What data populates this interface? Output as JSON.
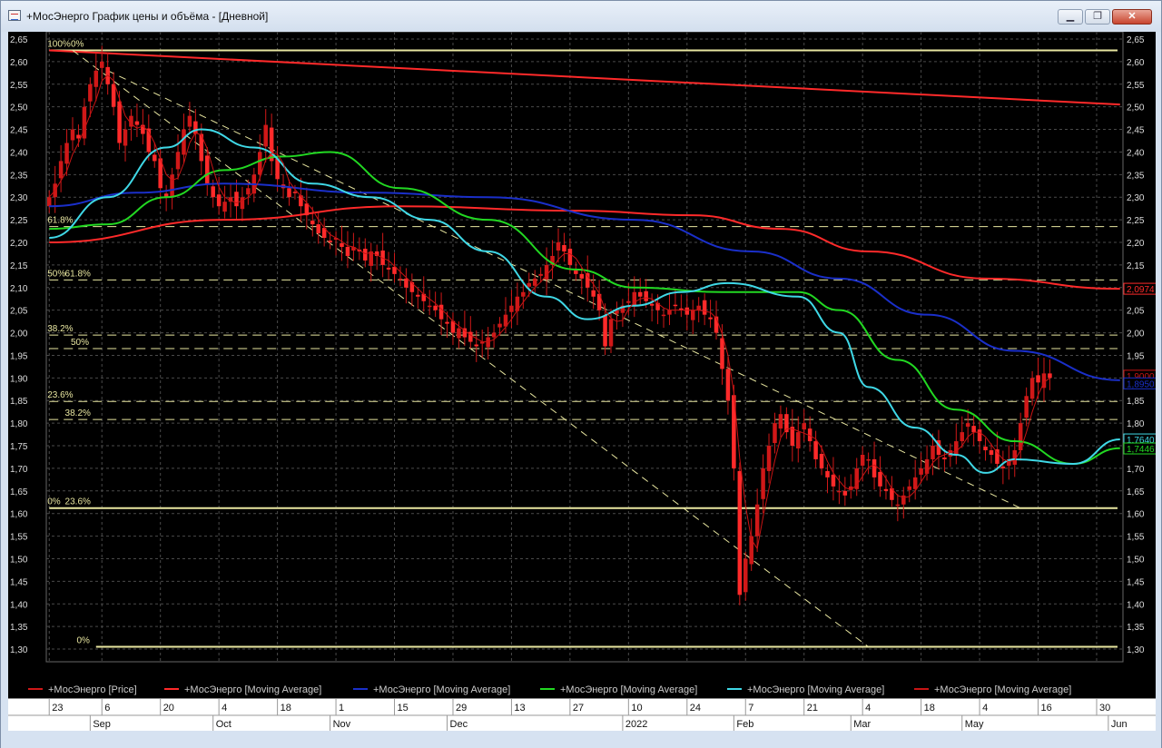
{
  "window": {
    "title": "+МосЭнерго График цены и объёма - [Дневной]",
    "minimize_glyph": "▁",
    "restore_glyph": "❐",
    "close_glyph": "✕"
  },
  "colors": {
    "background": "#000000",
    "grid": "#4a4a4a",
    "candle_up": "#d01818",
    "candle_down": "#ff2a2a",
    "fib_line": "#e8e6a0",
    "ma_red_thin": "#c81414",
    "ma_red_thick": "#ff2a2a",
    "ma_blue": "#1a2fc9",
    "ma_green": "#22d822",
    "ma_cyan": "#3fd8e6"
  },
  "chart_data": {
    "type": "line",
    "y_axis": {
      "min": 1.28,
      "max": 2.65,
      "ticks": [
        "2,65",
        "2,60",
        "2,55",
        "2,50",
        "2,45",
        "2,40",
        "2,35",
        "2,30",
        "2,25",
        "2,20",
        "2,15",
        "2,10",
        "2,05",
        "2,00",
        "1,95",
        "1,90",
        "1,85",
        "1,80",
        "1,75",
        "1,70",
        "1,65",
        "1,60",
        "1,55",
        "1,50",
        "1,45",
        "1,40",
        "1,35",
        "1,30"
      ],
      "tick_values": [
        2.65,
        2.6,
        2.55,
        2.5,
        2.45,
        2.4,
        2.35,
        2.3,
        2.25,
        2.2,
        2.15,
        2.1,
        2.05,
        2.0,
        1.95,
        1.9,
        1.85,
        1.8,
        1.75,
        1.7,
        1.65,
        1.6,
        1.55,
        1.5,
        1.45,
        1.4,
        1.35,
        1.3
      ]
    },
    "x_axis": {
      "days": [
        "23",
        "6",
        "20",
        "4",
        "18",
        "1",
        "15",
        "29",
        "13",
        "27",
        "10",
        "24",
        "7",
        "21",
        "4",
        "18",
        "4",
        "16",
        "30"
      ],
      "day_index": [
        0,
        9,
        19,
        29,
        39,
        49,
        59,
        69,
        79,
        89,
        99,
        109,
        119,
        129,
        139,
        149,
        159,
        169,
        179
      ],
      "months": [
        "Sep",
        "Oct",
        "Nov",
        "Dec",
        "2022",
        "Feb",
        "Mar",
        "May",
        "Jun"
      ],
      "month_index": [
        7,
        28,
        48,
        68,
        98,
        117,
        137,
        156,
        181
      ],
      "count": 184
    },
    "close": [
      2.3,
      2.33,
      2.38,
      2.42,
      2.45,
      2.43,
      2.5,
      2.55,
      2.58,
      2.6,
      2.55,
      2.5,
      2.42,
      2.45,
      2.48,
      2.46,
      2.44,
      2.4,
      2.38,
      2.32,
      2.3,
      2.35,
      2.4,
      2.45,
      2.48,
      2.44,
      2.38,
      2.33,
      2.3,
      2.28,
      2.29,
      2.3,
      2.28,
      2.3,
      2.32,
      2.35,
      2.4,
      2.46,
      2.38,
      2.34,
      2.32,
      2.3,
      2.31,
      2.28,
      2.26,
      2.24,
      2.22,
      2.21,
      2.2,
      2.21,
      2.19,
      2.17,
      2.19,
      2.18,
      2.16,
      2.18,
      2.17,
      2.15,
      2.14,
      2.13,
      2.12,
      2.1,
      2.09,
      2.08,
      2.07,
      2.06,
      2.05,
      2.03,
      2.02,
      2.0,
      2.01,
      1.99,
      1.98,
      1.97,
      1.98,
      1.99,
      2.0,
      2.02,
      2.04,
      2.06,
      2.08,
      2.09,
      2.11,
      2.12,
      2.13,
      2.15,
      2.17,
      2.2,
      2.18,
      2.15,
      2.13,
      2.12,
      2.1,
      2.08,
      2.05,
      1.97,
      2.03,
      2.05,
      2.06,
      2.07,
      2.09,
      2.08,
      2.07,
      2.06,
      2.05,
      2.04,
      2.05,
      2.06,
      2.05,
      2.04,
      2.05,
      2.06,
      2.04,
      2.03,
      2.0,
      1.92,
      1.85,
      1.7,
      1.42,
      1.5,
      1.55,
      1.62,
      1.7,
      1.75,
      1.8,
      1.82,
      1.78,
      1.75,
      1.78,
      1.8,
      1.76,
      1.72,
      1.7,
      1.68,
      1.66,
      1.65,
      1.64,
      1.66,
      1.7,
      1.73,
      1.72,
      1.68,
      1.66,
      1.65,
      1.63,
      1.62,
      1.64,
      1.66,
      1.68,
      1.7,
      1.72,
      1.75,
      1.73,
      1.72,
      1.74,
      1.76,
      1.78,
      1.8,
      1.78,
      1.76,
      1.74,
      1.73,
      1.71,
      1.7,
      1.72,
      1.74,
      1.8,
      1.86,
      1.9,
      1.89,
      1.91,
      1.9
    ],
    "series": [
      {
        "name": "+МосЭнерго [Price]",
        "color": "#d01818",
        "kind": "candles"
      },
      {
        "name": "+МосЭнерго [Moving Average]",
        "color": "#ff2a2a",
        "kind": "ma",
        "points": [
          [
            0,
            2.2
          ],
          [
            30,
            2.25
          ],
          [
            60,
            2.28
          ],
          [
            90,
            2.27
          ],
          [
            110,
            2.26
          ],
          [
            125,
            2.23
          ],
          [
            140,
            2.18
          ],
          [
            160,
            2.12
          ],
          [
            183,
            2.0974
          ]
        ],
        "width": 2
      },
      {
        "name": "+МосЭнерго [Moving Average]",
        "color": "#1a2fc9",
        "kind": "ma",
        "points": [
          [
            0,
            2.28
          ],
          [
            15,
            2.31
          ],
          [
            30,
            2.33
          ],
          [
            55,
            2.31
          ],
          [
            75,
            2.3
          ],
          [
            100,
            2.25
          ],
          [
            120,
            2.18
          ],
          [
            135,
            2.12
          ],
          [
            150,
            2.04
          ],
          [
            165,
            1.96
          ],
          [
            183,
            1.895
          ]
        ],
        "width": 2
      },
      {
        "name": "+МосЭнерго [Moving Average]",
        "color": "#22d822",
        "kind": "ma",
        "points": [
          [
            0,
            2.23
          ],
          [
            10,
            2.24
          ],
          [
            20,
            2.3
          ],
          [
            30,
            2.36
          ],
          [
            40,
            2.39
          ],
          [
            48,
            2.4
          ],
          [
            60,
            2.32
          ],
          [
            75,
            2.25
          ],
          [
            90,
            2.14
          ],
          [
            100,
            2.1
          ],
          [
            115,
            2.09
          ],
          [
            128,
            2.09
          ],
          [
            135,
            2.05
          ],
          [
            145,
            1.94
          ],
          [
            155,
            1.83
          ],
          [
            165,
            1.76
          ],
          [
            175,
            1.71
          ],
          [
            183,
            1.7446
          ]
        ],
        "width": 2
      },
      {
        "name": "+МосЭнерго [Moving Average]",
        "color": "#3fd8e6",
        "kind": "ma",
        "points": [
          [
            0,
            2.21
          ],
          [
            10,
            2.3
          ],
          [
            20,
            2.41
          ],
          [
            26,
            2.45
          ],
          [
            35,
            2.41
          ],
          [
            45,
            2.33
          ],
          [
            55,
            2.3
          ],
          [
            65,
            2.25
          ],
          [
            75,
            2.18
          ],
          [
            85,
            2.08
          ],
          [
            92,
            2.03
          ],
          [
            100,
            2.06
          ],
          [
            108,
            2.09
          ],
          [
            116,
            2.11
          ],
          [
            128,
            2.08
          ],
          [
            135,
            2.0
          ],
          [
            140,
            1.88
          ],
          [
            148,
            1.79
          ],
          [
            155,
            1.73
          ],
          [
            160,
            1.69
          ],
          [
            165,
            1.72
          ],
          [
            175,
            1.71
          ],
          [
            183,
            1.764
          ]
        ],
        "width": 2
      },
      {
        "name": "+МосЭнерго [Moving Average]",
        "color": "#c81414",
        "kind": "close_smooth",
        "width": 1
      }
    ],
    "top_red_line": {
      "from": [
        0,
        2.625
      ],
      "to": [
        183,
        2.505
      ]
    },
    "fib_levels": [
      {
        "label": "100%",
        "value": 2.625,
        "x0": 0,
        "label_x": 0
      },
      {
        "label": "0%",
        "value": 2.625,
        "x0": 0,
        "label_x": 4
      },
      {
        "label": "61.8%",
        "value": 2.235,
        "x0": 0,
        "label_x": 0
      },
      {
        "label": "50%",
        "value": 2.117,
        "x0": 0,
        "label_x": 0
      },
      {
        "label": "61.8%",
        "value": 2.117,
        "x0": 0,
        "label_x": 3
      },
      {
        "label": "38.2%",
        "value": 1.995,
        "x0": 0,
        "label_x": 0
      },
      {
        "label": "50%",
        "value": 1.965,
        "x0": 0,
        "label_x": 4
      },
      {
        "label": "23.6%",
        "value": 1.848,
        "x0": 0,
        "label_x": 0
      },
      {
        "label": "38.2%",
        "value": 1.808,
        "x0": 0,
        "label_x": 3
      },
      {
        "label": "0%",
        "value": 1.612,
        "x0": 0,
        "label_x": 0
      },
      {
        "label": "23.6%",
        "value": 1.612,
        "x0": 0,
        "label_x": 3
      },
      {
        "label": "0%",
        "value": 1.305,
        "x0": 8,
        "label_x": 5
      }
    ],
    "fib_solid": [
      2.625,
      1.612,
      1.305
    ],
    "trend_lines": [
      {
        "from": [
          4,
          2.625
        ],
        "to": [
          140,
          1.305
        ]
      },
      {
        "from": [
          10,
          2.58
        ],
        "to": [
          166,
          1.612
        ]
      }
    ],
    "right_badges": [
      {
        "label": "2,0974",
        "value": 2.0974,
        "color": "#ff2a2a"
      },
      {
        "label": "1,9000",
        "value": 1.905,
        "color": "#c81414"
      },
      {
        "label": "1,8950",
        "value": 1.888,
        "color": "#1a2fc9"
      },
      {
        "label": "1,7640",
        "value": 1.764,
        "color": "#3fd8e6"
      },
      {
        "label": "1,7446",
        "value": 1.744,
        "color": "#22d822"
      }
    ]
  }
}
